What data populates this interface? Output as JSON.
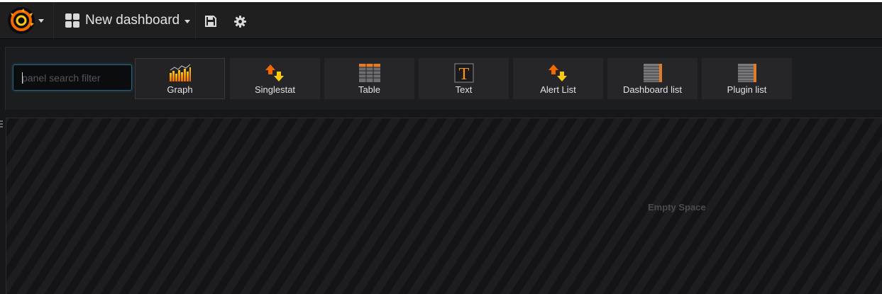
{
  "header": {
    "dashboard_title": "New dashboard",
    "logo_icon": "grafana-logo-icon",
    "grid_icon": "dashboard-grid-icon",
    "save_icon": "save-icon",
    "settings_icon": "gear-icon"
  },
  "panel_picker": {
    "search_placeholder": "panel search filter",
    "panels": [
      {
        "label": "Graph",
        "icon": "graph-icon",
        "selected": true
      },
      {
        "label": "Singlestat",
        "icon": "singlestat-icon"
      },
      {
        "label": "Table",
        "icon": "table-icon"
      },
      {
        "label": "Text",
        "icon": "text-icon"
      },
      {
        "label": "Alert List",
        "icon": "alert-list-icon"
      },
      {
        "label": "Dashboard list",
        "icon": "dashboard-list-icon"
      },
      {
        "label": "Plugin list",
        "icon": "plugin-list-icon"
      }
    ]
  },
  "canvas": {
    "empty_label": "Empty Space"
  },
  "colors": {
    "accent_orange": "#f7941d",
    "accent_yellow": "#fbca0a",
    "background": "#161719"
  }
}
